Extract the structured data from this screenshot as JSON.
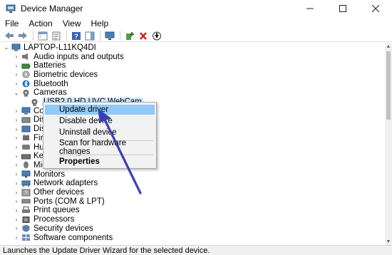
{
  "window": {
    "title": "Device Manager"
  },
  "menubar": [
    "File",
    "Action",
    "View",
    "Help"
  ],
  "toolbar_icons": [
    "back-arrow-icon",
    "forward-arrow-icon",
    "properties-pane-icon",
    "show-hidden-icon",
    "help-icon",
    "action-pane-icon",
    "monitor-icon",
    "add-driver-icon",
    "uninstall-icon",
    "update-icon"
  ],
  "tree": {
    "root": "LAPTOP-L11KQ4DI",
    "items": [
      {
        "label": "Audio inputs and outputs",
        "icon": "speaker-icon",
        "expanded": false
      },
      {
        "label": "Batteries",
        "icon": "battery-icon",
        "expanded": false
      },
      {
        "label": "Biometric devices",
        "icon": "fingerprint-icon",
        "expanded": false
      },
      {
        "label": "Bluetooth",
        "icon": "bluetooth-icon",
        "expanded": false
      },
      {
        "label": "Cameras",
        "icon": "camera-icon",
        "expanded": true
      },
      {
        "label": "USB2.0 HD UVC WebCam",
        "icon": "camera-icon",
        "child": true,
        "selected": true
      },
      {
        "label": "Com",
        "icon": "computer-icon",
        "expanded": false
      },
      {
        "label": "Disk",
        "icon": "disk-icon",
        "expanded": false
      },
      {
        "label": "Disp",
        "icon": "display-icon",
        "expanded": false
      },
      {
        "label": "Firm",
        "icon": "firmware-icon",
        "expanded": false
      },
      {
        "label": "Hum",
        "icon": "hid-icon",
        "expanded": false
      },
      {
        "label": "Key",
        "icon": "keyboard-icon",
        "expanded": false
      },
      {
        "label": "Mic",
        "icon": "mouse-icon",
        "expanded": false
      },
      {
        "label": "Monitors",
        "icon": "monitor-icon",
        "expanded": false
      },
      {
        "label": "Network adapters",
        "icon": "network-icon",
        "expanded": false
      },
      {
        "label": "Other devices",
        "icon": "other-device-icon",
        "expanded": false
      },
      {
        "label": "Ports (COM & LPT)",
        "icon": "port-icon",
        "expanded": false
      },
      {
        "label": "Print queues",
        "icon": "printer-icon",
        "expanded": false
      },
      {
        "label": "Processors",
        "icon": "processor-icon",
        "expanded": false
      },
      {
        "label": "Security devices",
        "icon": "security-icon",
        "expanded": false
      },
      {
        "label": "Software components",
        "icon": "software-icon",
        "expanded": false
      }
    ]
  },
  "context_menu": {
    "items": [
      {
        "label": "Update driver",
        "highlighted": true
      },
      {
        "label": "Disable device"
      },
      {
        "label": "Uninstall device"
      },
      {
        "label": "Scan for hardware changes"
      },
      {
        "label": "Properties",
        "bold": true
      }
    ]
  },
  "statusbar": {
    "text": "Launches the Update Driver Wizard for the selected device."
  },
  "colors": {
    "highlight": "#91c9f7",
    "selection": "#cce8ff",
    "arrow": "#3a3fb4"
  }
}
